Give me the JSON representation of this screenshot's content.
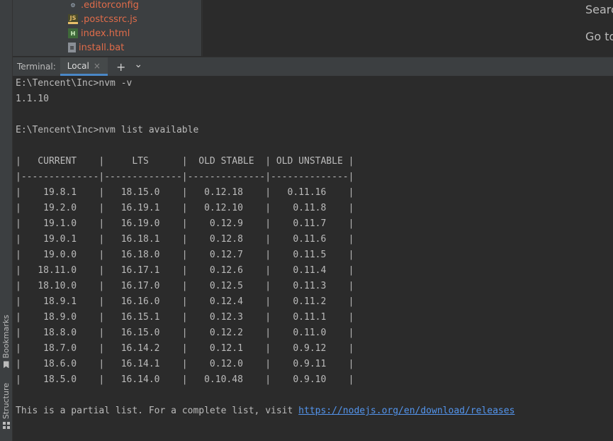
{
  "project": {
    "files": [
      {
        "name": ".editorconfig",
        "icon": "gear-icon"
      },
      {
        "name": ".postcssrc.js",
        "icon": "js-file-icon",
        "glyph": "JS"
      },
      {
        "name": "index.html",
        "icon": "html-file-icon",
        "glyph": "H"
      },
      {
        "name": "install.bat",
        "icon": "bat-file-icon"
      }
    ]
  },
  "editor": {
    "hint_search": "Searc",
    "hint_goto": "Go to"
  },
  "side_tabs": {
    "bookmarks": "Bookmarks",
    "structure": "Structure"
  },
  "terminal": {
    "label": "Terminal:",
    "tab_local": "Local",
    "tab_close": "×",
    "add": "+",
    "dropdown": "⌄",
    "lines": [
      "E:\\Tencent\\Inc>nvm -v",
      "1.1.10",
      "",
      "E:\\Tencent\\Inc>nvm list available",
      "",
      "|   CURRENT    |     LTS      |  OLD STABLE  | OLD UNSTABLE |",
      "|--------------|--------------|--------------|--------------|",
      "|    19.8.1    |   18.15.0    |   0.12.18    |   0.11.16    |",
      "|    19.2.0    |   16.19.1    |   0.12.10    |    0.11.8    |",
      "|    19.1.0    |   16.19.0    |    0.12.9    |    0.11.7    |",
      "|    19.0.1    |   16.18.1    |    0.12.8    |    0.11.6    |",
      "|    19.0.0    |   16.18.0    |    0.12.7    |    0.11.5    |",
      "|   18.11.0    |   16.17.1    |    0.12.6    |    0.11.4    |",
      "|   18.10.0    |   16.17.0    |    0.12.5    |    0.11.3    |",
      "|    18.9.1    |   16.16.0    |    0.12.4    |    0.11.2    |",
      "|    18.9.0    |   16.15.1    |    0.12.3    |    0.11.1    |",
      "|    18.8.0    |   16.15.0    |    0.12.2    |    0.11.0    |",
      "|    18.7.0    |   16.14.2    |    0.12.1    |    0.9.12    |",
      "|    18.6.0    |   16.14.1    |    0.12.0    |    0.9.11    |",
      "|    18.5.0    |   16.14.0    |   0.10.48    |    0.9.10    |",
      ""
    ],
    "footer_text": "This is a partial list. For a complete list, visit ",
    "footer_link": "https://nodejs.org/en/download/releases"
  },
  "colors": {
    "background": "#2b2b2b",
    "panel": "#3c3f41",
    "text": "#bbbbbb",
    "file_name": "#e06c4a",
    "link": "#5394ec",
    "active_tab_underline": "#4a88c7"
  }
}
